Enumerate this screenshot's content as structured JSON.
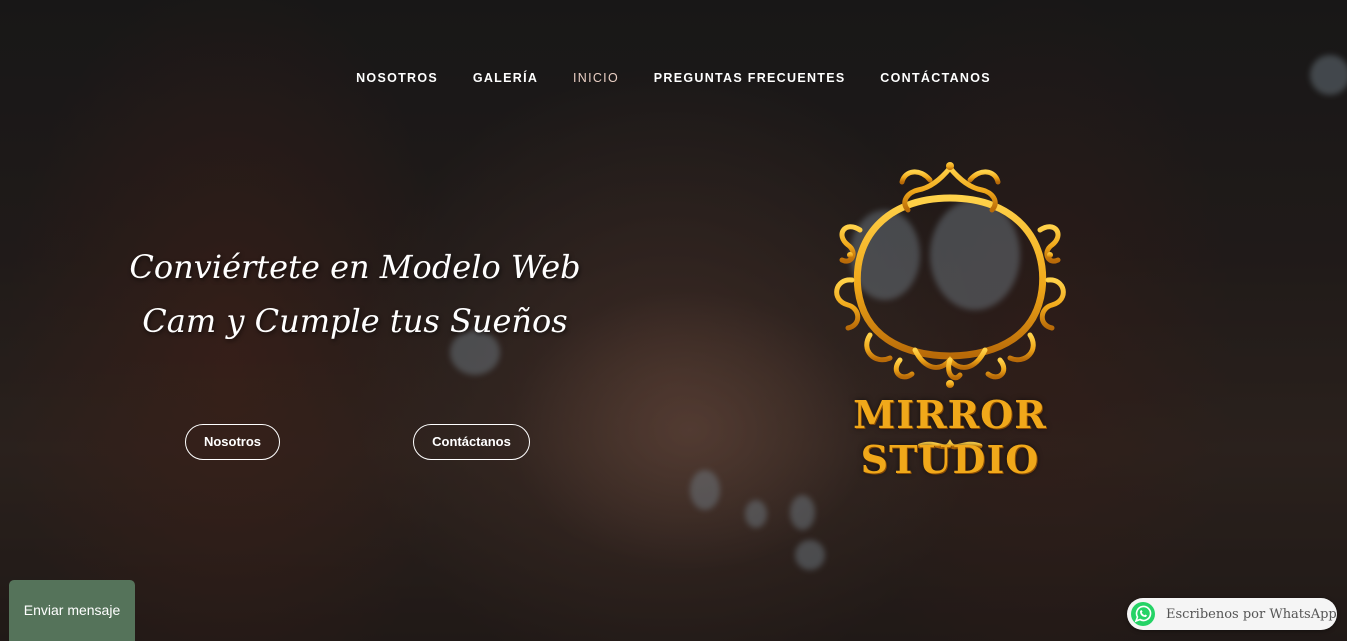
{
  "nav": {
    "items": [
      {
        "label": "NOSOTROS"
      },
      {
        "label": "GALERÍA"
      },
      {
        "label": "INICIO"
      },
      {
        "label": "PREGUNTAS FRECUENTES"
      },
      {
        "label": "CONTÁCTANOS"
      }
    ],
    "active_item": "INICIO"
  },
  "hero": {
    "headline_line1": "Conviértete en Modelo Web",
    "headline_line2": "Cam y Cumple tus Sueños",
    "buttons": {
      "nosotros_label": "Nosotros",
      "contact_label": "Contáctanos"
    }
  },
  "logo": {
    "text": "MIRROR STUDIO",
    "icon": "ornate-gold-frame-icon",
    "color": "#f0a81a"
  },
  "chat": {
    "send_message_label": "Enviar mensaje",
    "color": "#55735a"
  },
  "whatsapp": {
    "label": "Escribenos por WhatsApp",
    "icon": "whatsapp-icon",
    "color": "#25d366"
  }
}
